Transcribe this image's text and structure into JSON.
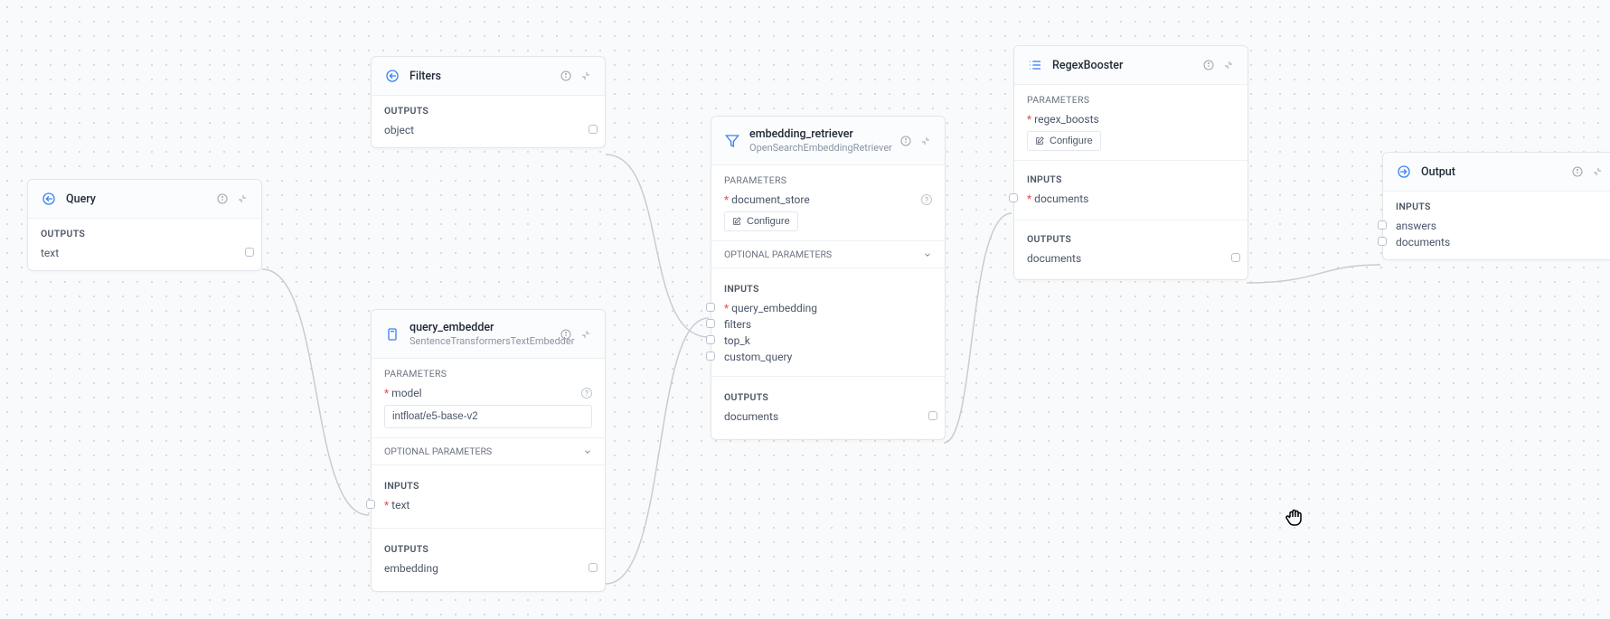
{
  "nodes": {
    "query": {
      "title": "Query",
      "outputs_label": "Outputs",
      "output_0": "text"
    },
    "filters": {
      "title": "Filters",
      "outputs_label": "Outputs",
      "output_0": "object"
    },
    "query_embedder": {
      "title": "query_embedder",
      "subtitle": "SentenceTransformersTextEmbedder",
      "params_label": "PARAMETERS",
      "param_model_label": "model",
      "param_model_value": "intfloat/e5-base-v2",
      "optional_label": "OPTIONAL PARAMETERS",
      "inputs_label": "Inputs",
      "input_0": "text",
      "outputs_label": "Outputs",
      "output_0": "embedding"
    },
    "embedding_retriever": {
      "title": "embedding_retriever",
      "subtitle": "OpenSearchEmbeddingRetriever",
      "params_label": "PARAMETERS",
      "param_docstore_label": "document_store",
      "configure_label": "Configure",
      "optional_label": "OPTIONAL PARAMETERS",
      "inputs_label": "Inputs",
      "input_0": "query_embedding",
      "input_1": "filters",
      "input_2": "top_k",
      "input_3": "custom_query",
      "outputs_label": "Outputs",
      "output_0": "documents"
    },
    "regex_booster": {
      "title": "RegexBooster",
      "params_label": "PARAMETERS",
      "param_regex_label": "regex_boosts",
      "configure_label": "Configure",
      "inputs_label": "Inputs",
      "input_0": "documents",
      "outputs_label": "Outputs",
      "output_0": "documents"
    },
    "output": {
      "title": "Output",
      "inputs_label": "Inputs",
      "input_0": "answers",
      "input_1": "documents"
    }
  },
  "colors": {
    "blue": "#3b82f6",
    "red": "#e34d4d"
  }
}
